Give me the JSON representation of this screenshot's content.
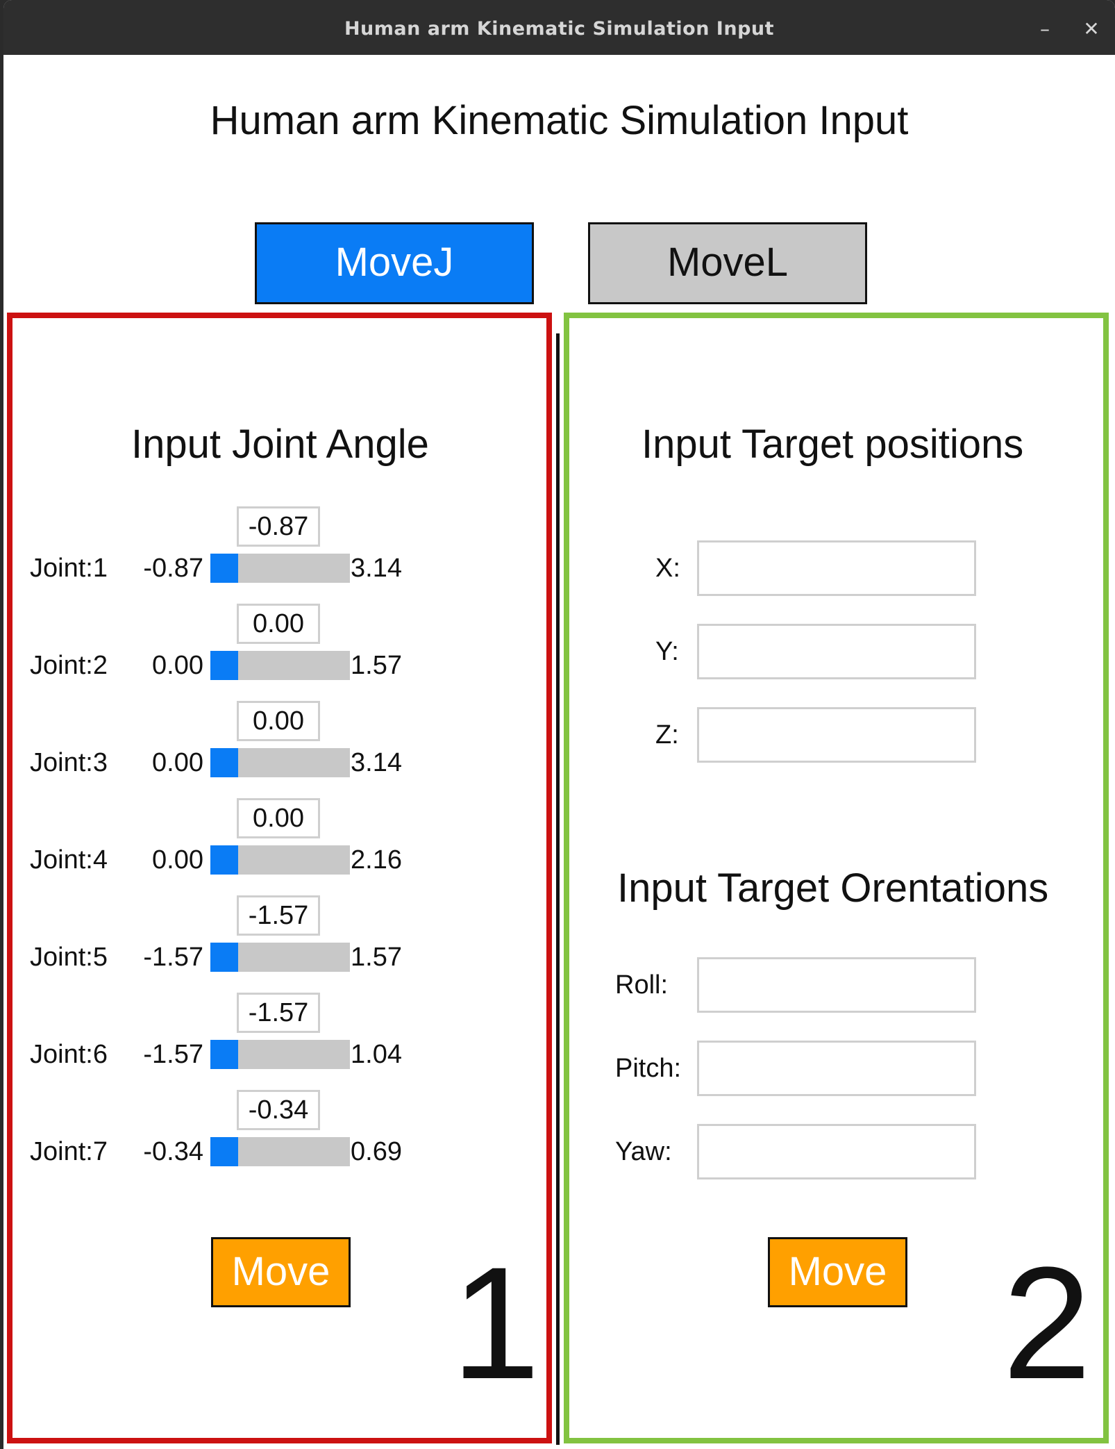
{
  "window": {
    "title": "Human arm Kinematic Simulation Input",
    "minimize_glyph": "–",
    "close_glyph": "✕"
  },
  "header": {
    "title": "Human arm Kinematic Simulation Input"
  },
  "modes": {
    "movej_label": "MoveJ",
    "movel_label": "MoveL",
    "active": "MoveJ"
  },
  "joint_panel": {
    "title": "Input Joint Angle",
    "joints": [
      {
        "label": "Joint:1",
        "min": "-0.87",
        "max": "3.14",
        "value": "-0.87"
      },
      {
        "label": "Joint:2",
        "min": "0.00",
        "max": "1.57",
        "value": "0.00"
      },
      {
        "label": "Joint:3",
        "min": "0.00",
        "max": "3.14",
        "value": "0.00"
      },
      {
        "label": "Joint:4",
        "min": "0.00",
        "max": "2.16",
        "value": "0.00"
      },
      {
        "label": "Joint:5",
        "min": "-1.57",
        "max": "1.57",
        "value": "-1.57"
      },
      {
        "label": "Joint:6",
        "min": "-1.57",
        "max": "1.04",
        "value": "-1.57"
      },
      {
        "label": "Joint:7",
        "min": "-0.34",
        "max": "0.69",
        "value": "-0.34"
      }
    ],
    "move_label": "Move",
    "marker": "1",
    "border_color": "#cc1111"
  },
  "target_panel": {
    "positions_title": "Input Target positions",
    "orientations_title": "Input Target Orentations",
    "fields": {
      "x_label": "X:",
      "x_value": "",
      "y_label": "Y:",
      "y_value": "",
      "z_label": "Z:",
      "z_value": "",
      "roll_label": "Roll:",
      "roll_value": "",
      "pitch_label": "Pitch:",
      "pitch_value": "",
      "yaw_label": "Yaw:",
      "yaw_value": ""
    },
    "move_label": "Move",
    "marker": "2",
    "border_color": "#82c341"
  },
  "colors": {
    "accent_blue": "#0a7cf5",
    "move_orange": "#ffa000",
    "slider_track": "#c8c8c8"
  }
}
